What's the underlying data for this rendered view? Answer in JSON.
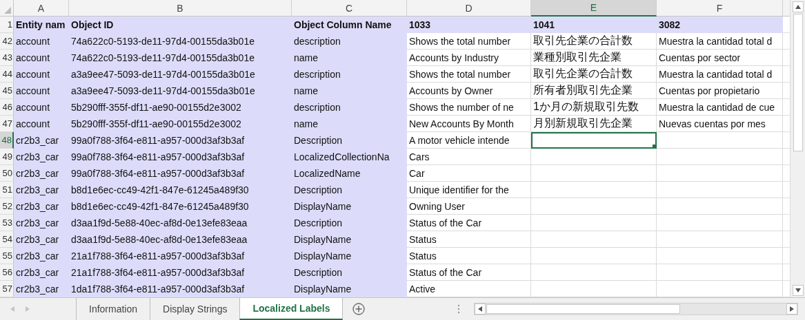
{
  "columns": [
    {
      "letter": "A",
      "selected": false,
      "shaded": true
    },
    {
      "letter": "B",
      "selected": false,
      "shaded": true
    },
    {
      "letter": "C",
      "selected": false,
      "shaded": true
    },
    {
      "letter": "D",
      "selected": false,
      "shaded": false
    },
    {
      "letter": "E",
      "selected": true,
      "shaded": false
    },
    {
      "letter": "F",
      "selected": false,
      "shaded": false
    }
  ],
  "rows": [
    {
      "number": "1",
      "selected": false,
      "header": true,
      "cells": [
        {
          "text": "Entity nam",
          "selected": false
        },
        {
          "text": "Object ID",
          "selected": false
        },
        {
          "text": "Object Column Name",
          "selected": false
        },
        {
          "text": "1033",
          "selected": false
        },
        {
          "text": "1041",
          "selected": false
        },
        {
          "text": "3082",
          "selected": false
        }
      ]
    },
    {
      "number": "42",
      "selected": false,
      "header": false,
      "cells": [
        {
          "text": "account",
          "selected": false
        },
        {
          "text": "74a622c0-5193-de11-97d4-00155da3b01e",
          "selected": false
        },
        {
          "text": "description",
          "selected": false
        },
        {
          "text": "Shows the total number",
          "selected": false
        },
        {
          "text": "取引先企業の合計数",
          "selected": false
        },
        {
          "text": "Muestra la cantidad total d",
          "selected": false
        }
      ]
    },
    {
      "number": "43",
      "selected": false,
      "header": false,
      "cells": [
        {
          "text": "account",
          "selected": false
        },
        {
          "text": "74a622c0-5193-de11-97d4-00155da3b01e",
          "selected": false
        },
        {
          "text": "name",
          "selected": false
        },
        {
          "text": "Accounts by Industry",
          "selected": false
        },
        {
          "text": "業種別取引先企業",
          "selected": false
        },
        {
          "text": "Cuentas por sector",
          "selected": false
        }
      ]
    },
    {
      "number": "44",
      "selected": false,
      "header": false,
      "cells": [
        {
          "text": "account",
          "selected": false
        },
        {
          "text": "a3a9ee47-5093-de11-97d4-00155da3b01e",
          "selected": false
        },
        {
          "text": "description",
          "selected": false
        },
        {
          "text": "Shows the total number",
          "selected": false
        },
        {
          "text": "取引先企業の合計数",
          "selected": false
        },
        {
          "text": "Muestra la cantidad total d",
          "selected": false
        }
      ]
    },
    {
      "number": "45",
      "selected": false,
      "header": false,
      "cells": [
        {
          "text": "account",
          "selected": false
        },
        {
          "text": "a3a9ee47-5093-de11-97d4-00155da3b01e",
          "selected": false
        },
        {
          "text": "name",
          "selected": false
        },
        {
          "text": "Accounts by Owner",
          "selected": false
        },
        {
          "text": "所有者別取引先企業",
          "selected": false
        },
        {
          "text": "Cuentas por propietario",
          "selected": false
        }
      ]
    },
    {
      "number": "46",
      "selected": false,
      "header": false,
      "cells": [
        {
          "text": "account",
          "selected": false
        },
        {
          "text": "5b290fff-355f-df11-ae90-00155d2e3002",
          "selected": false
        },
        {
          "text": "description",
          "selected": false
        },
        {
          "text": "Shows the number of ne",
          "selected": false
        },
        {
          "text": "1か月の新規取引先数",
          "selected": false
        },
        {
          "text": "Muestra la cantidad de cue",
          "selected": false
        }
      ]
    },
    {
      "number": "47",
      "selected": false,
      "header": false,
      "cells": [
        {
          "text": "account",
          "selected": false
        },
        {
          "text": "5b290fff-355f-df11-ae90-00155d2e3002",
          "selected": false
        },
        {
          "text": "name",
          "selected": false
        },
        {
          "text": "New Accounts By Month",
          "selected": false
        },
        {
          "text": "月別新規取引先企業",
          "selected": false
        },
        {
          "text": "Nuevas cuentas por mes",
          "selected": false
        }
      ]
    },
    {
      "number": "48",
      "selected": true,
      "header": false,
      "cells": [
        {
          "text": "cr2b3_car",
          "selected": false
        },
        {
          "text": "99a0f788-3f64-e811-a957-000d3af3b3af",
          "selected": false
        },
        {
          "text": "Description",
          "selected": false
        },
        {
          "text": "A motor vehicle intende",
          "selected": false
        },
        {
          "selected": true
        },
        {
          "selected": false
        }
      ]
    },
    {
      "number": "49",
      "selected": false,
      "header": false,
      "cells": [
        {
          "text": "cr2b3_car",
          "selected": false
        },
        {
          "text": "99a0f788-3f64-e811-a957-000d3af3b3af",
          "selected": false
        },
        {
          "text": "LocalizedCollectionNa",
          "selected": false
        },
        {
          "text": "Cars",
          "selected": false
        },
        {
          "selected": false
        },
        {
          "selected": false
        }
      ]
    },
    {
      "number": "50",
      "selected": false,
      "header": false,
      "cells": [
        {
          "text": "cr2b3_car",
          "selected": false
        },
        {
          "text": "99a0f788-3f64-e811-a957-000d3af3b3af",
          "selected": false
        },
        {
          "text": "LocalizedName",
          "selected": false
        },
        {
          "text": "Car",
          "selected": false
        },
        {
          "selected": false
        },
        {
          "selected": false
        }
      ]
    },
    {
      "number": "51",
      "selected": false,
      "header": false,
      "cells": [
        {
          "text": "cr2b3_car",
          "selected": false
        },
        {
          "text": "b8d1e6ec-cc49-42f1-847e-61245a489f30",
          "selected": false
        },
        {
          "text": "Description",
          "selected": false
        },
        {
          "text": "Unique identifier for the",
          "selected": false
        },
        {
          "selected": false
        },
        {
          "selected": false
        }
      ]
    },
    {
      "number": "52",
      "selected": false,
      "header": false,
      "cells": [
        {
          "text": "cr2b3_car",
          "selected": false
        },
        {
          "text": "b8d1e6ec-cc49-42f1-847e-61245a489f30",
          "selected": false
        },
        {
          "text": "DisplayName",
          "selected": false
        },
        {
          "text": "Owning User",
          "selected": false
        },
        {
          "selected": false
        },
        {
          "selected": false
        }
      ]
    },
    {
      "number": "53",
      "selected": false,
      "header": false,
      "cells": [
        {
          "text": "cr2b3_car",
          "selected": false
        },
        {
          "text": "d3aa1f9d-5e88-40ec-af8d-0e13efe83eaa",
          "selected": false
        },
        {
          "text": "Description",
          "selected": false
        },
        {
          "text": "Status of the Car",
          "selected": false
        },
        {
          "selected": false
        },
        {
          "selected": false
        }
      ]
    },
    {
      "number": "54",
      "selected": false,
      "header": false,
      "cells": [
        {
          "text": "cr2b3_car",
          "selected": false
        },
        {
          "text": "d3aa1f9d-5e88-40ec-af8d-0e13efe83eaa",
          "selected": false
        },
        {
          "text": "DisplayName",
          "selected": false
        },
        {
          "text": "Status",
          "selected": false
        },
        {
          "selected": false
        },
        {
          "selected": false
        }
      ]
    },
    {
      "number": "55",
      "selected": false,
      "header": false,
      "cells": [
        {
          "text": "cr2b3_car",
          "selected": false
        },
        {
          "text": "21a1f788-3f64-e811-a957-000d3af3b3af",
          "selected": false
        },
        {
          "text": "DisplayName",
          "selected": false
        },
        {
          "text": "Status",
          "selected": false
        },
        {
          "selected": false
        },
        {
          "selected": false
        }
      ]
    },
    {
      "number": "56",
      "selected": false,
      "header": false,
      "cells": [
        {
          "text": "cr2b3_car",
          "selected": false
        },
        {
          "text": "21a1f788-3f64-e811-a957-000d3af3b3af",
          "selected": false
        },
        {
          "text": "Description",
          "selected": false
        },
        {
          "text": "Status of the Car",
          "selected": false
        },
        {
          "selected": false
        },
        {
          "selected": false
        }
      ]
    },
    {
      "number": "57",
      "selected": false,
      "header": false,
      "cells": [
        {
          "text": "cr2b3_car",
          "selected": false
        },
        {
          "text": "1da1f788-3f64-e811-a957-000d3af3b3af",
          "selected": false
        },
        {
          "text": "DisplayName",
          "selected": false
        },
        {
          "text": "Active",
          "selected": false
        },
        {
          "selected": false
        },
        {
          "selected": false
        }
      ]
    }
  ],
  "sheet_tabs": [
    {
      "label": "Information",
      "selected": false
    },
    {
      "label": "Display Strings",
      "selected": false
    },
    {
      "label": "Localized Labels",
      "selected": true
    }
  ]
}
